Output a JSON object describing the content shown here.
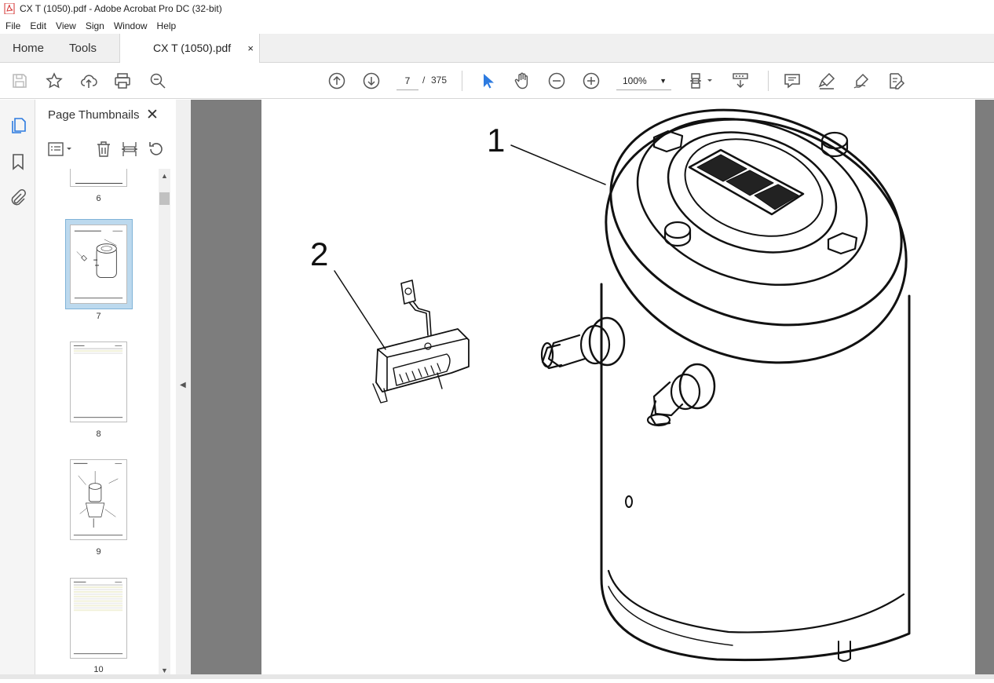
{
  "window": {
    "title": "CX T (1050).pdf - Adobe Acrobat Pro DC (32-bit)"
  },
  "menu": {
    "items": [
      "File",
      "Edit",
      "View",
      "Sign",
      "Window",
      "Help"
    ]
  },
  "tabs": {
    "home": "Home",
    "tools": "Tools",
    "document": "CX T (1050).pdf",
    "close": "×"
  },
  "toolbar": {
    "current_page": "7",
    "page_separator": "/",
    "total_pages": "375",
    "zoom": "100%"
  },
  "thumbnails": {
    "title": "Page Thumbnails",
    "close": "✕",
    "pages": [
      "6",
      "7",
      "8",
      "9",
      "10"
    ],
    "selected_page": "7"
  },
  "page_content": {
    "callouts": [
      "1",
      "2"
    ]
  },
  "colors": {
    "accent": "#2d7be0",
    "selection": "#bcd9ee",
    "viewer_bg": "#7d7d7d"
  },
  "icons": [
    "save-icon",
    "bookmark-star-icon",
    "upload-icon",
    "print-icon",
    "find-icon",
    "prev-page-icon",
    "next-page-icon",
    "select-cursor-icon",
    "hand-icon",
    "zoom-out-icon",
    "zoom-in-icon",
    "page-fit-icon",
    "scroll-mode-icon",
    "comment-icon",
    "highlight-icon",
    "sign-icon",
    "edit-pdf-icon"
  ]
}
